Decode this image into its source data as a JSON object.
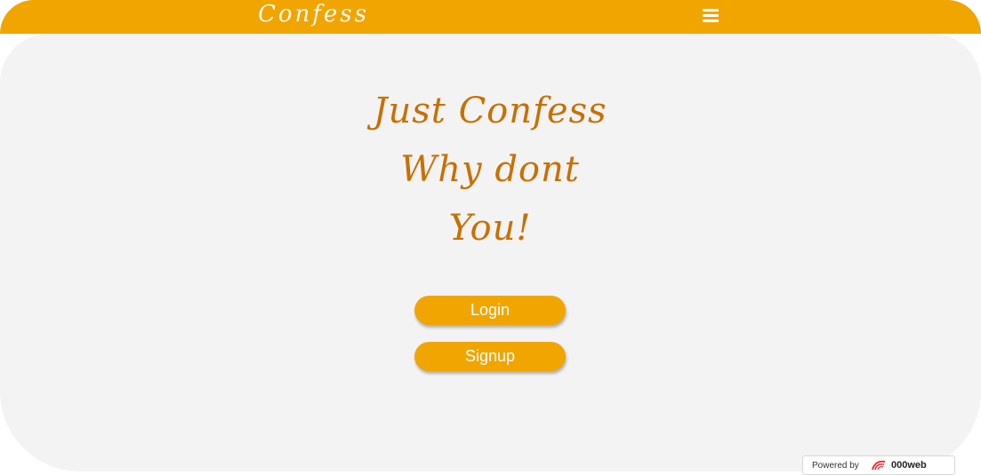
{
  "header": {
    "brand": "Confess",
    "menu_icon": "hamburger-menu-icon"
  },
  "hero": {
    "lines": [
      "Just Confess",
      "Why dont",
      "You!"
    ]
  },
  "actions": {
    "login_label": "Login",
    "signup_label": "Signup"
  },
  "footer_badge": {
    "prefix": "Powered by",
    "brand": "000web",
    "logo_icon": "000webhost-logo-icon"
  },
  "colors": {
    "accent": "#f0a500",
    "hero_text": "#c77000",
    "panel_bg": "#f4f3f3"
  }
}
